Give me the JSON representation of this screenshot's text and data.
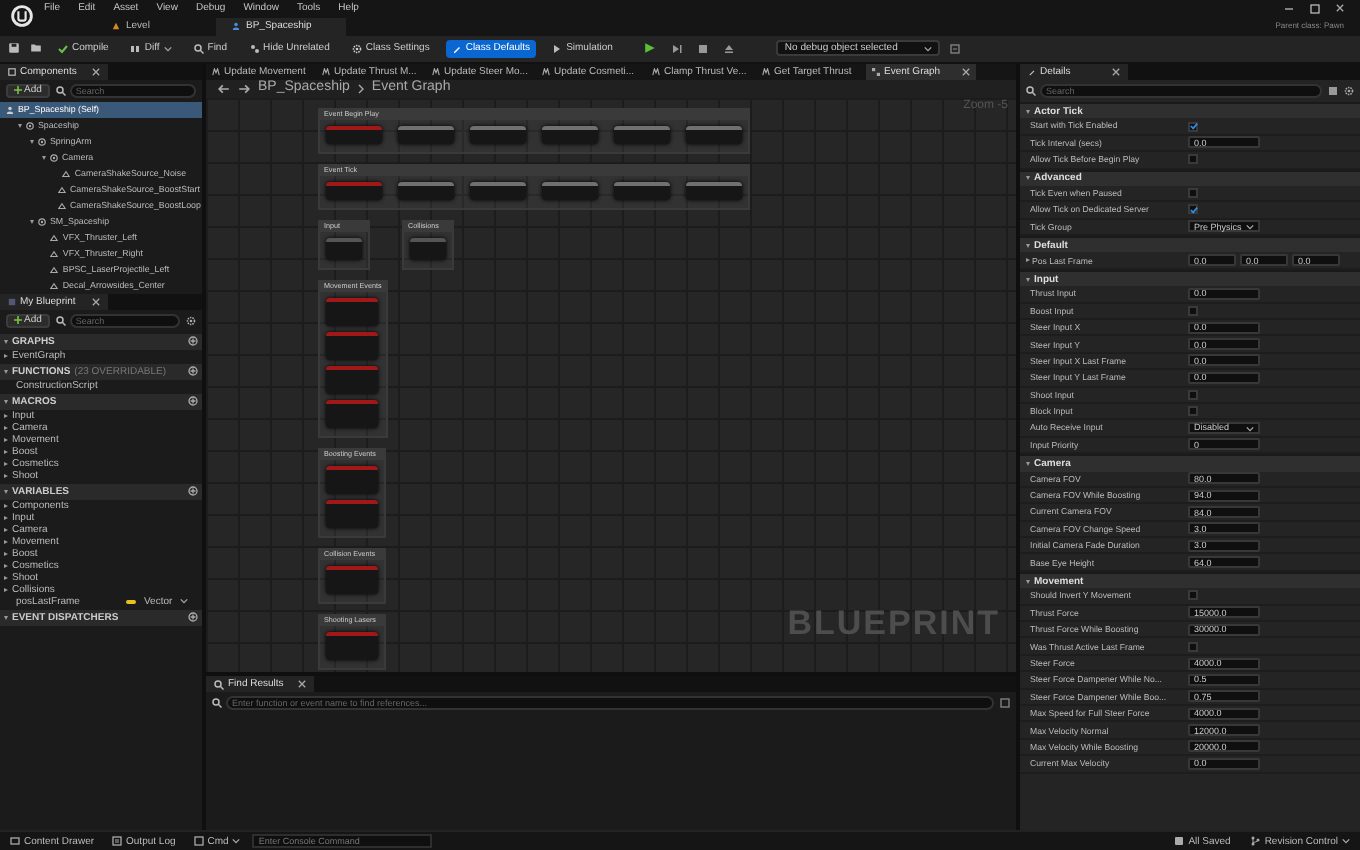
{
  "menu": [
    "File",
    "Edit",
    "Asset",
    "View",
    "Debug",
    "Window",
    "Tools",
    "Help"
  ],
  "doc_tabs": [
    {
      "label": "Level",
      "selected": false
    },
    {
      "label": "BP_Spaceship",
      "selected": true
    }
  ],
  "parent_class": "Parent class: Pawn",
  "toolbar": [
    {
      "label": "Compile",
      "kind": "compile",
      "selected": false
    },
    {
      "label": "Diff",
      "kind": "diff",
      "selected": false
    },
    {
      "label": "Find",
      "kind": "find",
      "selected": false
    },
    {
      "label": "Hide Unrelated",
      "kind": "hide",
      "selected": false
    },
    {
      "label": "Class Settings",
      "kind": "settings",
      "selected": false
    },
    {
      "label": "Class Defaults",
      "kind": "defaults",
      "selected": true
    },
    {
      "label": "Simulation",
      "kind": "sim",
      "selected": false
    }
  ],
  "debug_select": "No debug object selected",
  "components": {
    "title": "Components",
    "add": "Add",
    "search_placeholder": "Search",
    "tree": [
      {
        "label": "BP_Spaceship (Self)",
        "selected": true,
        "children": [
          {
            "label": "Spaceship",
            "selected": false,
            "expanded": true,
            "children": [
              {
                "label": "SpringArm",
                "selected": false,
                "expanded": true,
                "children": [
                  {
                    "label": "Camera",
                    "selected": false,
                    "expanded": true,
                    "children": [
                      {
                        "label": "CameraShakeSource_Noise",
                        "selected": false
                      },
                      {
                        "label": "CameraShakeSource_BoostStart",
                        "selected": false
                      },
                      {
                        "label": "CameraShakeSource_BoostLoop",
                        "selected": false
                      }
                    ]
                  }
                ]
              },
              {
                "label": "SM_Spaceship",
                "selected": false,
                "expanded": true,
                "children": [
                  {
                    "label": "VFX_Thruster_Left",
                    "selected": false
                  },
                  {
                    "label": "VFX_Thruster_Right",
                    "selected": false
                  },
                  {
                    "label": "BPSC_LaserProjectile_Left",
                    "selected": false
                  },
                  {
                    "label": "Decal_Arrowsides_Center",
                    "selected": false
                  }
                ]
              }
            ]
          }
        ]
      }
    ]
  },
  "my_blueprint": {
    "title": "My Blueprint",
    "add": "Add",
    "search_placeholder": "Search",
    "sections": [
      {
        "title": "GRAPHS",
        "items": [
          {
            "label": "EventGraph",
            "expanded": false
          }
        ]
      },
      {
        "title": "FUNCTIONS",
        "note": "(23 OVERRIDABLE)",
        "items": [
          {
            "label": "ConstructionScript"
          }
        ]
      },
      {
        "title": "MACROS",
        "items": [
          {
            "label": "Input",
            "expanded": false
          },
          {
            "label": "Camera",
            "expanded": false
          },
          {
            "label": "Movement",
            "expanded": false
          },
          {
            "label": "Boost",
            "expanded": false
          },
          {
            "label": "Cosmetics",
            "expanded": false
          },
          {
            "label": "Shoot",
            "expanded": false
          }
        ]
      },
      {
        "title": "VARIABLES",
        "items": [
          {
            "label": "Components",
            "expanded": false
          },
          {
            "label": "Input",
            "expanded": false
          },
          {
            "label": "Camera",
            "expanded": false
          },
          {
            "label": "Movement",
            "expanded": false
          },
          {
            "label": "Boost",
            "expanded": false
          },
          {
            "label": "Cosmetics",
            "expanded": false
          },
          {
            "label": "Shoot",
            "expanded": false
          },
          {
            "label": "Collisions",
            "expanded": false
          },
          {
            "label": "posLastFrame",
            "type": "Vector",
            "color": "#e8c21c"
          }
        ]
      },
      {
        "title": "EVENT DISPATCHERS"
      }
    ]
  },
  "graph_tabs": [
    {
      "label": "Update Movement",
      "selected": false
    },
    {
      "label": "Update Thrust M...",
      "selected": false
    },
    {
      "label": "Update Steer Mo...",
      "selected": false
    },
    {
      "label": "Update Cosmeti...",
      "selected": false
    },
    {
      "label": "Clamp Thrust Ve...",
      "selected": false
    },
    {
      "label": "Get Target Thrust",
      "selected": false
    },
    {
      "label": "Event Graph",
      "selected": true
    }
  ],
  "breadcrumb": [
    "BP_Spaceship",
    "Event Graph"
  ],
  "zoom": "Zoom -5",
  "graph": {
    "label": "BLUEPRINT",
    "rows": [
      [
        {
          "title": "Event Begin Play",
          "kind": "row",
          "nodes": [
            {
              "kind": "event"
            },
            {
              "kind": "function"
            },
            {
              "kind": "function"
            },
            {
              "kind": "function"
            },
            {
              "kind": "function"
            },
            {
              "kind": "function"
            }
          ]
        }
      ],
      [
        {
          "title": "Event Tick",
          "kind": "row",
          "nodes": [
            {
              "kind": "event"
            },
            {
              "kind": "function"
            },
            {
              "kind": "function"
            },
            {
              "kind": "function"
            },
            {
              "kind": "function"
            },
            {
              "kind": "function"
            }
          ]
        }
      ],
      [
        {
          "title": "Input",
          "kind": "row",
          "nodes": [
            {
              "kind": "macro"
            }
          ]
        },
        {
          "title": "Collisions",
          "kind": "row",
          "nodes": [
            {
              "kind": "macro"
            }
          ]
        }
      ],
      [
        {
          "title": "Movement Events",
          "kind": "column",
          "nodes": [
            {
              "kind": "event"
            },
            {
              "kind": "event"
            },
            {
              "kind": "event"
            },
            {
              "kind": "event"
            }
          ]
        }
      ],
      [
        {
          "title": "Boosting Events",
          "kind": "column",
          "nodes": [
            {
              "kind": "event"
            },
            {
              "kind": "event"
            }
          ]
        }
      ],
      [
        {
          "title": "Collision Events",
          "kind": "column",
          "nodes": [
            {
              "kind": "event"
            }
          ]
        }
      ],
      [
        {
          "title": "Shooting Lasers",
          "kind": "column",
          "nodes": [
            {
              "kind": "event"
            }
          ]
        }
      ]
    ]
  },
  "find_results": {
    "title": "Find Results",
    "placeholder": "Enter function or event name to find references..."
  },
  "details": {
    "title": "Details",
    "search_placeholder": "Search",
    "sections": [
      {
        "title": "Actor Tick",
        "expanded": true,
        "rows": [
          {
            "label": "Start with Tick Enabled",
            "kind": "check",
            "checked": true
          },
          {
            "label": "Tick Interval (secs)",
            "kind": "number",
            "value": "0.0"
          },
          {
            "label": "Allow Tick Before Begin Play",
            "kind": "check",
            "checked": false
          }
        ]
      },
      {
        "title": "Advanced",
        "expanded": true,
        "rows": [
          {
            "label": "Tick Even when Paused",
            "kind": "check",
            "checked": false
          },
          {
            "label": "Allow Tick on Dedicated Server",
            "kind": "check",
            "checked": true
          },
          {
            "label": "Tick Group",
            "kind": "dropdown",
            "value": "Pre Physics"
          }
        ]
      },
      {
        "title": "Default",
        "expanded": true,
        "rows": [
          {
            "label": "Pos Last Frame",
            "kind": "vector",
            "expanded": false,
            "values": [
              "0.0",
              "0.0",
              "0.0"
            ]
          }
        ]
      },
      {
        "title": "Input",
        "expanded": true,
        "rows": [
          {
            "label": "Thrust Input",
            "kind": "number",
            "value": "0.0"
          },
          {
            "label": "Boost Input",
            "kind": "check",
            "checked": false
          },
          {
            "label": "Steer Input X",
            "kind": "number",
            "value": "0.0"
          },
          {
            "label": "Steer Input Y",
            "kind": "number",
            "value": "0.0"
          },
          {
            "label": "Steer Input X Last Frame",
            "kind": "number",
            "value": "0.0"
          },
          {
            "label": "Steer Input Y Last Frame",
            "kind": "number",
            "value": "0.0"
          },
          {
            "label": "Shoot Input",
            "kind": "check",
            "checked": false
          },
          {
            "label": "Block Input",
            "kind": "check",
            "checked": false
          },
          {
            "label": "Auto Receive Input",
            "kind": "dropdown",
            "value": "Disabled"
          },
          {
            "label": "Input Priority",
            "kind": "number",
            "value": "0"
          }
        ]
      },
      {
        "title": "Camera",
        "expanded": true,
        "rows": [
          {
            "label": "Camera FOV",
            "kind": "number",
            "value": "80.0"
          },
          {
            "label": "Camera FOV While Boosting",
            "kind": "number",
            "value": "94.0"
          },
          {
            "label": "Current Camera FOV",
            "kind": "number",
            "value": "84.0"
          },
          {
            "label": "Camera FOV Change Speed",
            "kind": "number",
            "value": "3.0"
          },
          {
            "label": "Initial Camera Fade Duration",
            "kind": "number",
            "value": "3.0"
          },
          {
            "label": "Base Eye Height",
            "kind": "number",
            "value": "64.0"
          }
        ]
      },
      {
        "title": "Movement",
        "expanded": true,
        "rows": [
          {
            "label": "Should Invert Y Movement",
            "kind": "check",
            "checked": false
          },
          {
            "label": "Thrust Force",
            "kind": "number",
            "value": "15000.0"
          },
          {
            "label": "Thrust Force While Boosting",
            "kind": "number",
            "value": "30000.0"
          },
          {
            "label": "Was Thrust Active Last Frame",
            "kind": "check",
            "checked": false
          },
          {
            "label": "Steer Force",
            "kind": "number",
            "value": "4000.0"
          },
          {
            "label": "Steer Force Dampener While No...",
            "kind": "number",
            "value": "0.5"
          },
          {
            "label": "Steer Force Dampener While Boo...",
            "kind": "number",
            "value": "0.75"
          },
          {
            "label": "Max Speed for Full Steer Force",
            "kind": "number",
            "value": "4000.0"
          },
          {
            "label": "Max Velocity Normal",
            "kind": "number",
            "value": "12000.0"
          },
          {
            "label": "Max Velocity While Boosting",
            "kind": "number",
            "value": "20000.0"
          },
          {
            "label": "Current Max Velocity",
            "kind": "number",
            "value": "0.0"
          }
        ]
      }
    ]
  },
  "status_bar": {
    "left": [
      {
        "label": "Content Drawer",
        "kind": "drawer"
      },
      {
        "label": "Output Log",
        "kind": "log"
      },
      {
        "label": "Cmd",
        "kind": "cmd"
      }
    ],
    "console_placeholder": "Enter Console Command",
    "right": [
      {
        "label": "All Saved",
        "kind": "saved"
      },
      {
        "label": "Revision Control",
        "kind": "revision"
      }
    ]
  }
}
